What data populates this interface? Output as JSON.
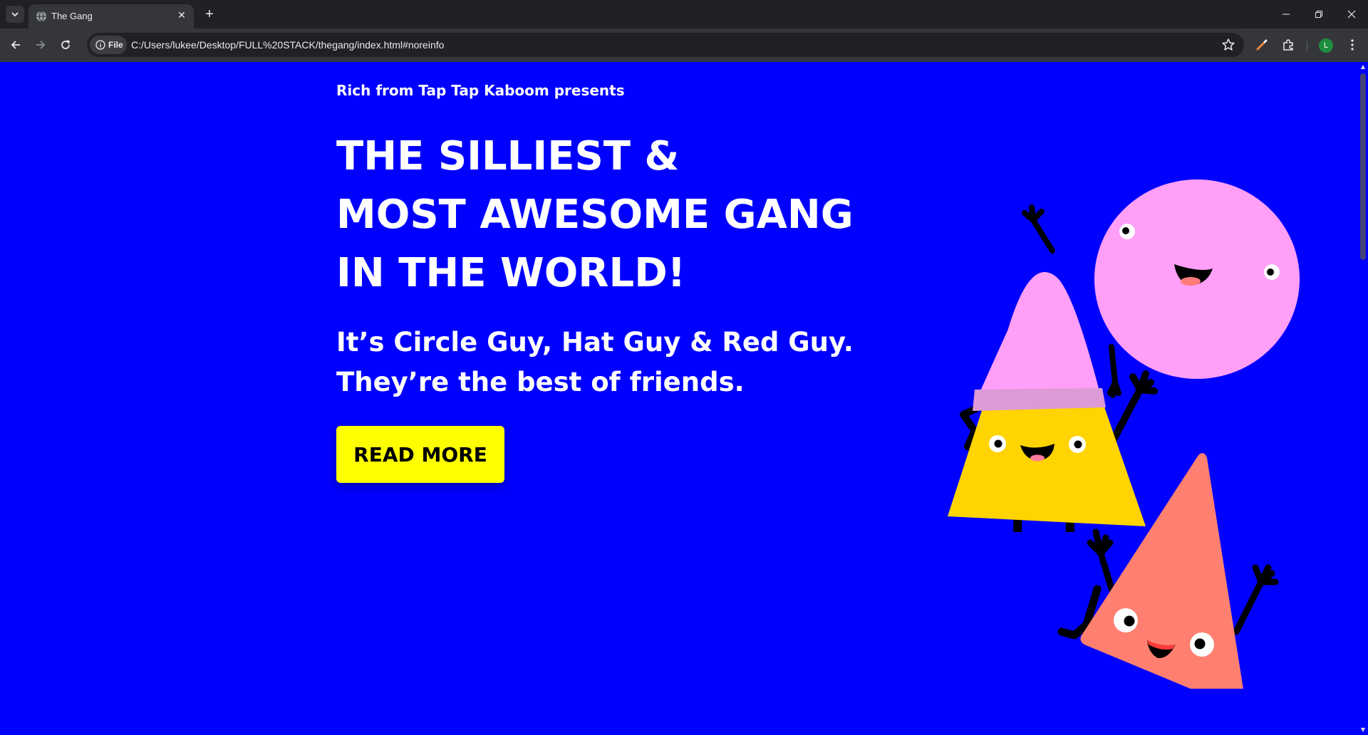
{
  "browser": {
    "tab_title": "The Gang",
    "address_chip": "File",
    "url": "C:/Users/lukee/Desktop/FULL%20STACK/thegang/index.html#noreinfo",
    "profile_initial": "L"
  },
  "page": {
    "presents": "Rich from Tap Tap Kaboom presents",
    "headline_lines": [
      "THE SILLIEST &",
      "MOST AWESOME GANG",
      "IN THE WORLD!"
    ],
    "sub_lines": [
      "It’s Circle Guy, Hat Guy & Red Guy.",
      "They’re the best of friends."
    ],
    "cta_label": "READ MORE"
  },
  "colors": {
    "background": "#0000ff",
    "cta": "#ffff00",
    "circle_guy": "#ff9ff7",
    "hat_guy_body": "#ffd400",
    "hat_guy_hat": "#ff9ff7",
    "red_guy": "#ff8070"
  },
  "illustration": {
    "characters": [
      "circle-guy",
      "hat-guy",
      "red-guy"
    ]
  }
}
